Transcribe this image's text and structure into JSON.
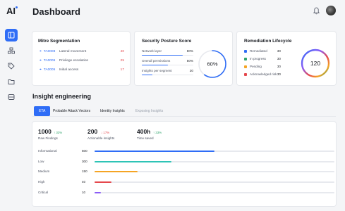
{
  "app": {
    "logo": "AI",
    "title": "Dashboard"
  },
  "colors": {
    "accent": "#2f6df6",
    "danger": "#e5484d",
    "success": "#30a46c",
    "warning": "#f5a524",
    "teal": "#2ec4b6",
    "purple": "#8b5cf6"
  },
  "mitre": {
    "title": "Mitre Segmentation",
    "rows": [
      {
        "code": "TA0008",
        "label": "Lateral movement",
        "value": "40"
      },
      {
        "code": "TA0006",
        "label": "Privilege escalation",
        "value": "25"
      },
      {
        "code": "TA0005",
        "label": "Initial access",
        "value": "17"
      }
    ]
  },
  "posture": {
    "title": "Security Posture Score",
    "score": "60%",
    "score_fraction": 0.6,
    "rows": [
      {
        "label": "Network layer",
        "value": "80%",
        "fraction": 0.8
      },
      {
        "label": "Overall permissions",
        "value": "50%",
        "fraction": 0.5
      },
      {
        "label": "Insights per segment",
        "value": "20",
        "fraction": 0.2
      }
    ]
  },
  "remediation": {
    "title": "Remediation Lifecycle",
    "total": "120",
    "rows": [
      {
        "label": "Remediated",
        "value": "30",
        "color": "#2f6df6"
      },
      {
        "label": "In progress",
        "value": "30",
        "color": "#30a46c"
      },
      {
        "label": "Pending",
        "value": "30",
        "color": "#f5a524"
      },
      {
        "label": "Acknowledged risk",
        "value": "30",
        "color": "#e5484d"
      }
    ]
  },
  "insight": {
    "section_title": "Insight engineering",
    "tabs": [
      "ETA",
      "Probable Attack Vectors",
      "Identity Insights",
      "Exposing Insights"
    ],
    "metrics": [
      {
        "value": "1000",
        "delta": "↑ 33%",
        "delta_color": "#30a46c",
        "label": "Raw Findings"
      },
      {
        "value": "200",
        "delta": "↓ 17%",
        "delta_color": "#e5484d",
        "label": "Actionable insights"
      },
      {
        "value": "400h",
        "delta": "↑ 33%",
        "delta_color": "#30a46c",
        "label": "Time saved"
      }
    ],
    "severities": [
      {
        "label": "Informational",
        "count": "500",
        "fraction": 0.5,
        "color": "#2f6df6"
      },
      {
        "label": "Low",
        "count": "300",
        "fraction": 0.32,
        "color": "#2ec4b6"
      },
      {
        "label": "Medium",
        "count": "150",
        "fraction": 0.18,
        "color": "#f5a524"
      },
      {
        "label": "High",
        "count": "40",
        "fraction": 0.07,
        "color": "#e5484d"
      },
      {
        "label": "Critical",
        "count": "10",
        "fraction": 0.025,
        "color": "#8b5cf6"
      }
    ]
  }
}
